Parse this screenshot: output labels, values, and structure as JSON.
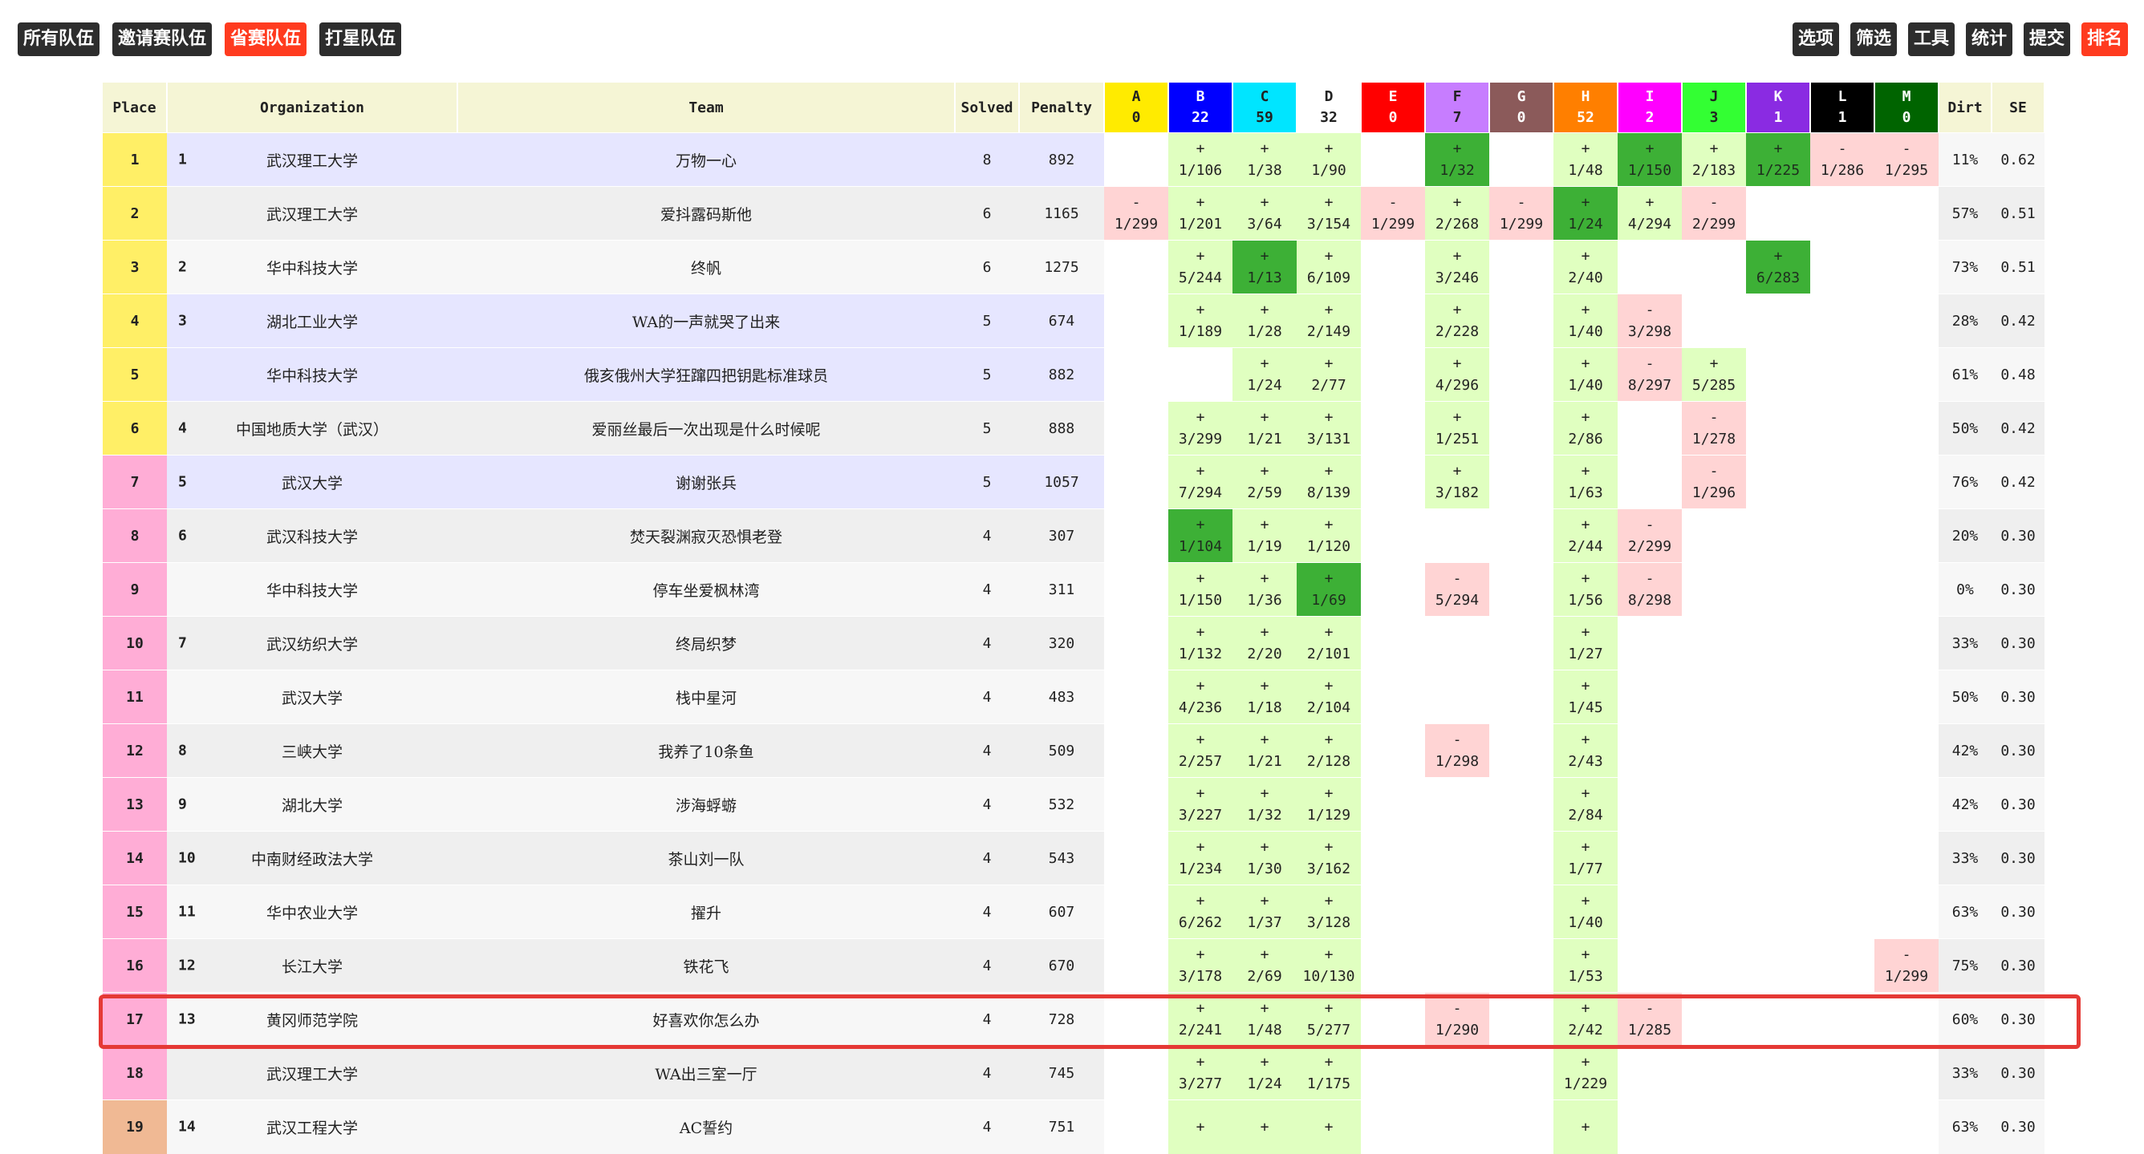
{
  "toolbar": {
    "left": [
      {
        "label": "所有队伍",
        "active": false
      },
      {
        "label": "邀请赛队伍",
        "active": false
      },
      {
        "label": "省赛队伍",
        "active": true
      },
      {
        "label": "打星队伍",
        "active": false
      }
    ],
    "right": [
      {
        "label": "选项",
        "active": false
      },
      {
        "label": "筛选",
        "active": false
      },
      {
        "label": "工具",
        "active": false
      },
      {
        "label": "统计",
        "active": false
      },
      {
        "label": "提交",
        "active": false
      },
      {
        "label": "排名",
        "active": true
      }
    ]
  },
  "columns": {
    "place": "Place",
    "organization": "Organization",
    "team": "Team",
    "solved": "Solved",
    "penalty": "Penalty",
    "dirt": "Dirt",
    "se": "SE"
  },
  "problems": [
    {
      "id": "A",
      "count": "0",
      "color": "#ffeb00",
      "text": "#222222"
    },
    {
      "id": "B",
      "count": "22",
      "color": "#0000ff",
      "text": "#ffffff"
    },
    {
      "id": "C",
      "count": "59",
      "color": "#00e5ff",
      "text": "#222222"
    },
    {
      "id": "D",
      "count": "32",
      "color": "#ffffff",
      "text": "#222222"
    },
    {
      "id": "E",
      "count": "0",
      "color": "#ff0000",
      "text": "#ffffff"
    },
    {
      "id": "F",
      "count": "7",
      "color": "#c77dff",
      "text": "#222222"
    },
    {
      "id": "G",
      "count": "0",
      "color": "#8b5a5a",
      "text": "#ffffff"
    },
    {
      "id": "H",
      "count": "52",
      "color": "#ff7f00",
      "text": "#ffffff"
    },
    {
      "id": "I",
      "count": "2",
      "color": "#ff00ff",
      "text": "#ffffff"
    },
    {
      "id": "J",
      "count": "3",
      "color": "#33ff33",
      "text": "#222222"
    },
    {
      "id": "K",
      "count": "1",
      "color": "#8a2be2",
      "text": "#ffffff"
    },
    {
      "id": "L",
      "count": "1",
      "color": "#000000",
      "text": "#ffffff"
    },
    {
      "id": "M",
      "count": "0",
      "color": "#006400",
      "text": "#ffffff"
    }
  ],
  "medal_colors": {
    "gold": "#ffef66",
    "silver": "#ffadd6",
    "bronze": "#f0b994"
  },
  "rows": [
    {
      "place": "1",
      "rank": "1",
      "org": "武汉理工大学",
      "team": "万物一心",
      "solved": "8",
      "penalty": "892",
      "medal": "gold",
      "teambg": "#e6e6ff",
      "cells": [
        null,
        [
          "+",
          "1/106",
          "ok"
        ],
        [
          "+",
          "1/38",
          "ok"
        ],
        [
          "+",
          "1/90",
          "ok"
        ],
        null,
        [
          "+",
          "1/32",
          "first"
        ],
        null,
        [
          "+",
          "1/48",
          "ok"
        ],
        [
          "+",
          "1/150",
          "first"
        ],
        [
          "+",
          "2/183",
          "ok"
        ],
        [
          "+",
          "1/225",
          "first"
        ],
        [
          "-",
          "1/286",
          "fail"
        ],
        [
          "-",
          "1/295",
          "fail"
        ]
      ],
      "dirt": "11%",
      "se": "0.62"
    },
    {
      "place": "2",
      "rank": "",
      "org": "武汉理工大学",
      "team": "爱抖露码斯他",
      "solved": "6",
      "penalty": "1165",
      "medal": "gold",
      "teambg": "",
      "cells": [
        [
          "-",
          "1/299",
          "fail"
        ],
        [
          "+",
          "1/201",
          "ok"
        ],
        [
          "+",
          "3/64",
          "ok"
        ],
        [
          "+",
          "3/154",
          "ok"
        ],
        [
          "-",
          "1/299",
          "fail"
        ],
        [
          "+",
          "2/268",
          "ok"
        ],
        [
          "-",
          "1/299",
          "fail"
        ],
        [
          "+",
          "1/24",
          "first"
        ],
        [
          "+",
          "4/294",
          "ok"
        ],
        [
          "-",
          "2/299",
          "fail"
        ],
        null,
        null,
        null
      ],
      "dirt": "57%",
      "se": "0.51"
    },
    {
      "place": "3",
      "rank": "2",
      "org": "华中科技大学",
      "team": "终帆",
      "solved": "6",
      "penalty": "1275",
      "medal": "gold",
      "teambg": "",
      "cells": [
        null,
        [
          "+",
          "5/244",
          "ok"
        ],
        [
          "+",
          "1/13",
          "first"
        ],
        [
          "+",
          "6/109",
          "ok"
        ],
        null,
        [
          "+",
          "3/246",
          "ok"
        ],
        null,
        [
          "+",
          "2/40",
          "ok"
        ],
        null,
        null,
        [
          "+",
          "6/283",
          "first"
        ],
        null,
        null
      ],
      "dirt": "73%",
      "se": "0.51"
    },
    {
      "place": "4",
      "rank": "3",
      "org": "湖北工业大学",
      "team": "WA的一声就哭了出来",
      "solved": "5",
      "penalty": "674",
      "medal": "gold",
      "teambg": "#e6e6ff",
      "cells": [
        null,
        [
          "+",
          "1/189",
          "ok"
        ],
        [
          "+",
          "1/28",
          "ok"
        ],
        [
          "+",
          "2/149",
          "ok"
        ],
        null,
        [
          "+",
          "2/228",
          "ok"
        ],
        null,
        [
          "+",
          "1/40",
          "ok"
        ],
        [
          "-",
          "3/298",
          "fail"
        ],
        null,
        null,
        null,
        null
      ],
      "dirt": "28%",
      "se": "0.42"
    },
    {
      "place": "5",
      "rank": "",
      "org": "华中科技大学",
      "team": "俄亥俄州大学狂蹿四把钥匙标准球员",
      "solved": "5",
      "penalty": "882",
      "medal": "gold",
      "teambg": "#e6e6ff",
      "cells": [
        null,
        null,
        [
          "+",
          "1/24",
          "ok"
        ],
        [
          "+",
          "2/77",
          "ok"
        ],
        null,
        [
          "+",
          "4/296",
          "ok"
        ],
        null,
        [
          "+",
          "1/40",
          "ok"
        ],
        [
          "-",
          "8/297",
          "fail"
        ],
        [
          "+",
          "5/285",
          "ok"
        ],
        null,
        null,
        null
      ],
      "dirt": "61%",
      "se": "0.48"
    },
    {
      "place": "6",
      "rank": "4",
      "org": "中国地质大学（武汉）",
      "team": "爱丽丝最后一次出现是什么时候呢",
      "solved": "5",
      "penalty": "888",
      "medal": "gold",
      "teambg": "",
      "cells": [
        null,
        [
          "+",
          "3/299",
          "ok"
        ],
        [
          "+",
          "1/21",
          "ok"
        ],
        [
          "+",
          "3/131",
          "ok"
        ],
        null,
        [
          "+",
          "1/251",
          "ok"
        ],
        null,
        [
          "+",
          "2/86",
          "ok"
        ],
        null,
        [
          "-",
          "1/278",
          "fail"
        ],
        null,
        null,
        null
      ],
      "dirt": "50%",
      "se": "0.42"
    },
    {
      "place": "7",
      "rank": "5",
      "org": "武汉大学",
      "team": "谢谢张兵",
      "solved": "5",
      "penalty": "1057",
      "medal": "silver",
      "teambg": "#e6e6ff",
      "cells": [
        null,
        [
          "+",
          "7/294",
          "ok"
        ],
        [
          "+",
          "2/59",
          "ok"
        ],
        [
          "+",
          "8/139",
          "ok"
        ],
        null,
        [
          "+",
          "3/182",
          "ok"
        ],
        null,
        [
          "+",
          "1/63",
          "ok"
        ],
        null,
        [
          "-",
          "1/296",
          "fail"
        ],
        null,
        null,
        null
      ],
      "dirt": "76%",
      "se": "0.42"
    },
    {
      "place": "8",
      "rank": "6",
      "org": "武汉科技大学",
      "team": "焚天裂渊寂灭恐惧老登",
      "solved": "4",
      "penalty": "307",
      "medal": "silver",
      "teambg": "",
      "cells": [
        null,
        [
          "+",
          "1/104",
          "first"
        ],
        [
          "+",
          "1/19",
          "ok"
        ],
        [
          "+",
          "1/120",
          "ok"
        ],
        null,
        null,
        null,
        [
          "+",
          "2/44",
          "ok"
        ],
        [
          "-",
          "2/299",
          "fail"
        ],
        null,
        null,
        null,
        null
      ],
      "dirt": "20%",
      "se": "0.30"
    },
    {
      "place": "9",
      "rank": "",
      "org": "华中科技大学",
      "team": "停车坐爱枫林湾",
      "solved": "4",
      "penalty": "311",
      "medal": "silver",
      "teambg": "",
      "cells": [
        null,
        [
          "+",
          "1/150",
          "ok"
        ],
        [
          "+",
          "1/36",
          "ok"
        ],
        [
          "+",
          "1/69",
          "first"
        ],
        null,
        [
          "-",
          "5/294",
          "fail"
        ],
        null,
        [
          "+",
          "1/56",
          "ok"
        ],
        [
          "-",
          "8/298",
          "fail"
        ],
        null,
        null,
        null,
        null
      ],
      "dirt": "0%",
      "se": "0.30"
    },
    {
      "place": "10",
      "rank": "7",
      "org": "武汉纺织大学",
      "team": "终局织梦",
      "solved": "4",
      "penalty": "320",
      "medal": "silver",
      "teambg": "",
      "cells": [
        null,
        [
          "+",
          "1/132",
          "ok"
        ],
        [
          "+",
          "2/20",
          "ok"
        ],
        [
          "+",
          "2/101",
          "ok"
        ],
        null,
        null,
        null,
        [
          "+",
          "1/27",
          "ok"
        ],
        null,
        null,
        null,
        null,
        null
      ],
      "dirt": "33%",
      "se": "0.30"
    },
    {
      "place": "11",
      "rank": "",
      "org": "武汉大学",
      "team": "栈中星河",
      "solved": "4",
      "penalty": "483",
      "medal": "silver",
      "teambg": "",
      "cells": [
        null,
        [
          "+",
          "4/236",
          "ok"
        ],
        [
          "+",
          "1/18",
          "ok"
        ],
        [
          "+",
          "2/104",
          "ok"
        ],
        null,
        null,
        null,
        [
          "+",
          "1/45",
          "ok"
        ],
        null,
        null,
        null,
        null,
        null
      ],
      "dirt": "50%",
      "se": "0.30"
    },
    {
      "place": "12",
      "rank": "8",
      "org": "三峡大学",
      "team": "我养了10条鱼",
      "solved": "4",
      "penalty": "509",
      "medal": "silver",
      "teambg": "",
      "cells": [
        null,
        [
          "+",
          "2/257",
          "ok"
        ],
        [
          "+",
          "1/21",
          "ok"
        ],
        [
          "+",
          "2/128",
          "ok"
        ],
        null,
        [
          "-",
          "1/298",
          "fail"
        ],
        null,
        [
          "+",
          "2/43",
          "ok"
        ],
        null,
        null,
        null,
        null,
        null
      ],
      "dirt": "42%",
      "se": "0.30"
    },
    {
      "place": "13",
      "rank": "9",
      "org": "湖北大学",
      "team": "涉海蜉蝣",
      "solved": "4",
      "penalty": "532",
      "medal": "silver",
      "teambg": "",
      "cells": [
        null,
        [
          "+",
          "3/227",
          "ok"
        ],
        [
          "+",
          "1/32",
          "ok"
        ],
        [
          "+",
          "1/129",
          "ok"
        ],
        null,
        null,
        null,
        [
          "+",
          "2/84",
          "ok"
        ],
        null,
        null,
        null,
        null,
        null
      ],
      "dirt": "42%",
      "se": "0.30"
    },
    {
      "place": "14",
      "rank": "10",
      "org": "中南财经政法大学",
      "team": "茶山刘一队",
      "solved": "4",
      "penalty": "543",
      "medal": "silver",
      "teambg": "",
      "cells": [
        null,
        [
          "+",
          "1/234",
          "ok"
        ],
        [
          "+",
          "1/30",
          "ok"
        ],
        [
          "+",
          "3/162",
          "ok"
        ],
        null,
        null,
        null,
        [
          "+",
          "1/77",
          "ok"
        ],
        null,
        null,
        null,
        null,
        null
      ],
      "dirt": "33%",
      "se": "0.30"
    },
    {
      "place": "15",
      "rank": "11",
      "org": "华中农业大学",
      "team": "擢升",
      "solved": "4",
      "penalty": "607",
      "medal": "silver",
      "teambg": "",
      "cells": [
        null,
        [
          "+",
          "6/262",
          "ok"
        ],
        [
          "+",
          "1/37",
          "ok"
        ],
        [
          "+",
          "3/128",
          "ok"
        ],
        null,
        null,
        null,
        [
          "+",
          "1/40",
          "ok"
        ],
        null,
        null,
        null,
        null,
        null
      ],
      "dirt": "63%",
      "se": "0.30"
    },
    {
      "place": "16",
      "rank": "12",
      "org": "长江大学",
      "team": "铁花飞",
      "solved": "4",
      "penalty": "670",
      "medal": "silver",
      "teambg": "",
      "cells": [
        null,
        [
          "+",
          "3/178",
          "ok"
        ],
        [
          "+",
          "2/69",
          "ok"
        ],
        [
          "+",
          "10/130",
          "ok"
        ],
        null,
        null,
        null,
        [
          "+",
          "1/53",
          "ok"
        ],
        null,
        null,
        null,
        null,
        [
          "-",
          "1/299",
          "fail"
        ]
      ],
      "dirt": "75%",
      "se": "0.30"
    },
    {
      "place": "17",
      "rank": "13",
      "org": "黄冈师范学院",
      "team": "好喜欢你怎么办",
      "solved": "4",
      "penalty": "728",
      "medal": "silver",
      "teambg": "",
      "cells": [
        null,
        [
          "+",
          "2/241",
          "ok"
        ],
        [
          "+",
          "1/48",
          "ok"
        ],
        [
          "+",
          "5/277",
          "ok"
        ],
        null,
        [
          "-",
          "1/290",
          "fail"
        ],
        null,
        [
          "+",
          "2/42",
          "ok"
        ],
        [
          "-",
          "1/285",
          "fail"
        ],
        null,
        null,
        null,
        null
      ],
      "dirt": "60%",
      "se": "0.30"
    },
    {
      "place": "18",
      "rank": "",
      "org": "武汉理工大学",
      "team": "WA出三室一厅",
      "solved": "4",
      "penalty": "745",
      "medal": "silver",
      "teambg": "",
      "cells": [
        null,
        [
          "+",
          "3/277",
          "ok"
        ],
        [
          "+",
          "1/24",
          "ok"
        ],
        [
          "+",
          "1/175",
          "ok"
        ],
        null,
        null,
        null,
        [
          "+",
          "1/229",
          "ok"
        ],
        null,
        null,
        null,
        null,
        null
      ],
      "dirt": "33%",
      "se": "0.30"
    },
    {
      "place": "19",
      "rank": "14",
      "org": "武汉工程大学",
      "team": "AC誓约",
      "solved": "4",
      "penalty": "751",
      "medal": "bronze",
      "teambg": "",
      "cells": [
        null,
        [
          "+",
          "",
          "ok"
        ],
        [
          "+",
          "",
          "ok"
        ],
        [
          "+",
          "",
          "ok"
        ],
        null,
        null,
        null,
        [
          "+",
          "",
          "ok"
        ],
        null,
        null,
        null,
        null,
        null
      ],
      "dirt": "63%",
      "se": "0.30"
    }
  ]
}
